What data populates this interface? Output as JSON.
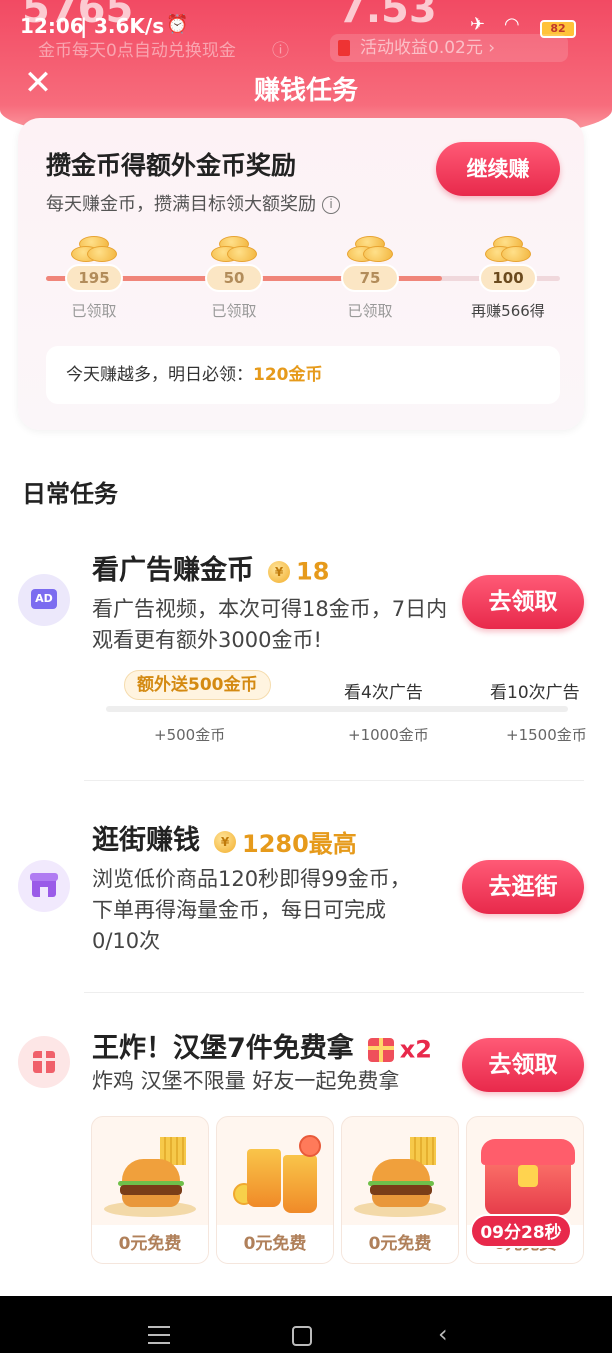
{
  "status_bar": {
    "time": "12:06",
    "speed": "3.6K/s",
    "battery": "82",
    "top_ghost_left": "5765",
    "top_ghost_right": "7.53",
    "coin_note": "金币每天0点自动兑换现金",
    "activity_income": "活动收益0.02元"
  },
  "header": {
    "title": "赚钱任务"
  },
  "reward_card": {
    "title": "攒金币得额外金币奖励",
    "subtitle": "每天赚金币，攒满目标领大额奖励",
    "button": "继续赚",
    "progress": 0.77,
    "milestones": [
      {
        "value": "195",
        "label": "已领取"
      },
      {
        "value": "50",
        "label": "已领取"
      },
      {
        "value": "75",
        "label": "已领取"
      },
      {
        "value": "100",
        "label": "再赚566得"
      }
    ],
    "today_text": "今天赚越多，明日必领：",
    "today_reward": "120金币"
  },
  "daily_section": {
    "title": "日常任务"
  },
  "tasks": [
    {
      "icon": "AD",
      "title": "看广告赚金币",
      "reward": "18",
      "desc": "看广告视频，本次可得18金币，7日内观看更有额外3000金币!",
      "button": "去领取",
      "bonus_pill": "额外送500金币",
      "steps": [
        {
          "label": "",
          "amount": "+500金币"
        },
        {
          "label": "看4次广告",
          "amount": "+1000金币"
        },
        {
          "label": "看10次广告",
          "amount": "+1500金币"
        }
      ]
    },
    {
      "icon": "shop-icon",
      "title": "逛街赚钱",
      "reward": "1280最高",
      "desc": "浏览低价商品120秒即得99金币，下单再得海量金币，每日可完成0/10次",
      "button": "去逛街"
    },
    {
      "icon": "gift-icon",
      "title": "王炸！汉堡7件免费拿",
      "reward": "x2",
      "desc": "炸鸡 汉堡不限量 好友一起免费拿",
      "button": "去领取",
      "products": [
        {
          "label": "0元免费"
        },
        {
          "label": "0元免费"
        },
        {
          "label": "0元免费"
        },
        {
          "label": "0元免费"
        }
      ],
      "timer": "09分28秒"
    }
  ],
  "colors": {
    "primary": "#e8294b",
    "accent_gold": "#e69a1b",
    "header": "#f24a63"
  }
}
